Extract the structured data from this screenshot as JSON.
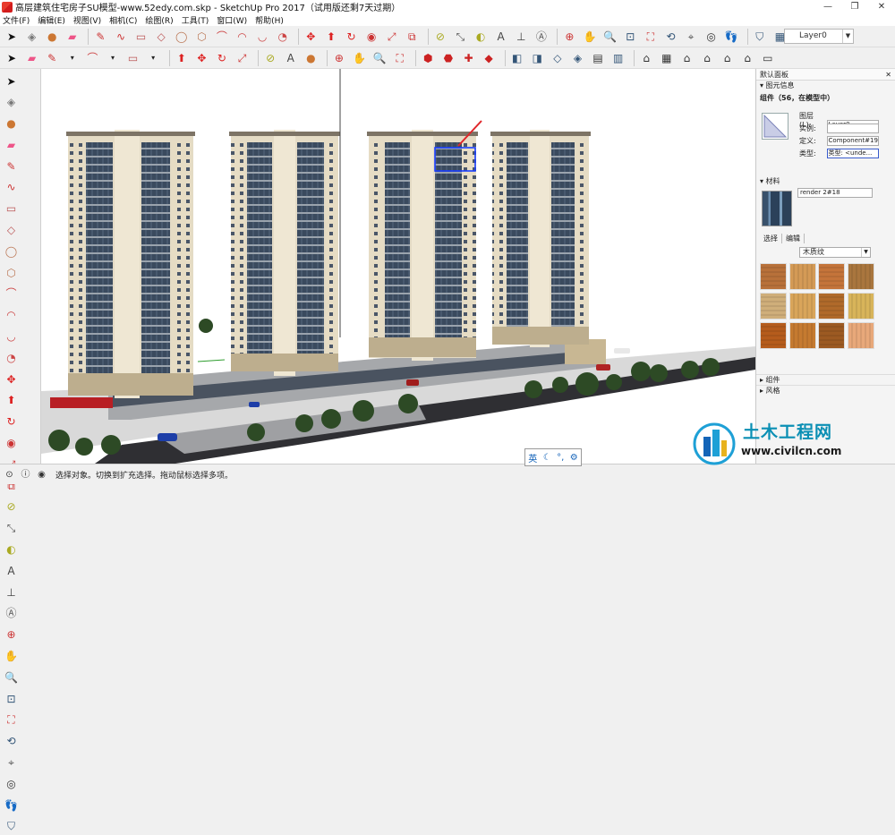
{
  "window": {
    "title": "高层建筑住宅房子SU模型-www.52edy.com.skp - SketchUp Pro 2017（试用版还剩7天过期）",
    "controls": [
      "—",
      "❐",
      "✕"
    ]
  },
  "menu": [
    "文件(F)",
    "编辑(E)",
    "视图(V)",
    "相机(C)",
    "绘图(R)",
    "工具(T)",
    "窗口(W)",
    "帮助(H)"
  ],
  "toolbar": {
    "layer_value": "Layer0"
  },
  "panel": {
    "title": "默认面板",
    "entity_section": "▾ 图元信息",
    "entity_title": "组件（56，在模型中）",
    "fields": [
      {
        "key": "图层(L):",
        "value": "Layer0"
      },
      {
        "key": "实例:",
        "value": ""
      },
      {
        "key": "定义:",
        "value": "Component#19"
      },
      {
        "key": "类型:",
        "value": "类型: <unde..."
      }
    ],
    "material_section": "▾ 材料",
    "material_name": "render 2#18",
    "tab_select": "选择",
    "tab_edit": "编辑",
    "library": "木质纹",
    "collapsed": [
      "▸ 组件",
      "▸ 风格"
    ]
  },
  "materials_colors": [
    "#b8713a",
    "#d49a56",
    "#c4743a",
    "#a9763e",
    "#cfae7a",
    "#d9a55a",
    "#b06a2a",
    "#d8b45a",
    "#b55c1c",
    "#c57a30",
    "#9c5a22",
    "#e8a87a"
  ],
  "status": {
    "text": "选择对象。切换到扩充选择。拖动鼠标选择多项。"
  },
  "ime": {
    "lang": "英"
  },
  "watermark": {
    "name": "土木工程网",
    "url": "www.civilcn.com"
  }
}
